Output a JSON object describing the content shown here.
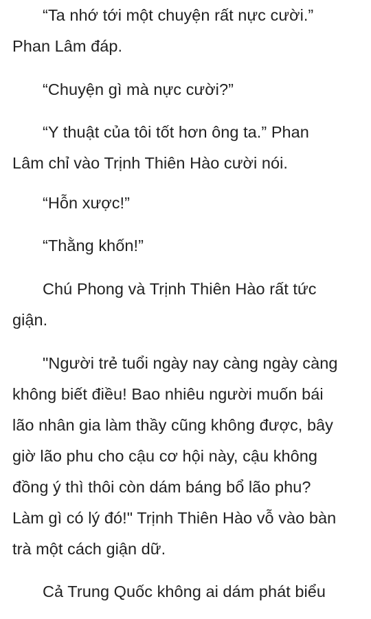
{
  "paragraphs": [
    {
      "lines": [
        "“Ta nhớ tới một chuyện rất nực cười.”",
        "Phan Lâm đáp."
      ]
    },
    {
      "lines": [
        "“Chuyện gì mà nực cười?”"
      ]
    },
    {
      "lines": [
        "“Y thuật của tôi tốt hơn ông ta.” Phan",
        "Lâm chỉ vào Trịnh Thiên Hào cười nói."
      ]
    },
    {
      "lines": [
        "“Hỗn xược!”"
      ]
    },
    {
      "lines": [
        "“Thằng khốn!”"
      ]
    },
    {
      "lines": [
        "Chú Phong và Trịnh Thiên Hào rất tức",
        "giận."
      ]
    },
    {
      "lines": [
        "\"Người trẻ tuổi ngày nay càng ngày càng",
        "không biết điều! Bao nhiêu người muốn bái",
        "lão nhân gia làm thầy cũng không được, bây",
        "giờ lão phu cho cậu cơ hội này, cậu không",
        "đồng ý thì thôi còn dám báng bổ lão phu?",
        "Làm gì có lý đó!\" Trịnh Thiên Hào vỗ vào bàn",
        "trà một cách giận dữ."
      ]
    },
    {
      "lines": [
        "Cả Trung Quốc không ai dám phát biểu"
      ]
    }
  ]
}
